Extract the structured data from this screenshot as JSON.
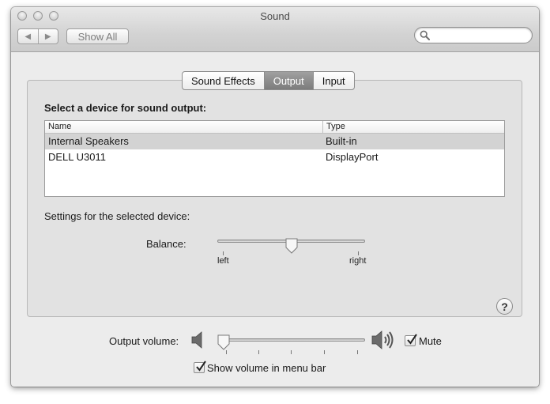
{
  "window": {
    "title": "Sound",
    "nav_back_icon": "back-arrow-icon",
    "nav_forward_icon": "forward-arrow-icon",
    "show_all_label": "Show All",
    "search": {
      "value": "",
      "placeholder": ""
    }
  },
  "tabs": [
    {
      "label": "Sound Effects",
      "active": false
    },
    {
      "label": "Output",
      "active": true
    },
    {
      "label": "Input",
      "active": false
    }
  ],
  "output": {
    "heading": "Select a device for sound output:",
    "columns": {
      "name": "Name",
      "type": "Type"
    },
    "devices": [
      {
        "name": "Internal Speakers",
        "type": "Built-in",
        "selected": true
      },
      {
        "name": "DELL U3011",
        "type": "DisplayPort",
        "selected": false
      }
    ],
    "settings_label": "Settings for the selected device:",
    "balance": {
      "label": "Balance:",
      "left_label": "left",
      "right_label": "right",
      "value": 0.5
    }
  },
  "help_label": "?",
  "volume": {
    "label": "Output volume:",
    "value": 0.0,
    "mute_label": "Mute",
    "mute_checked": true,
    "show_in_menubar_label": "Show volume in menu bar",
    "show_in_menubar_checked": true
  },
  "colors": {
    "selected_row": "#d3d3d3",
    "active_tab": "#8a8a8a"
  }
}
